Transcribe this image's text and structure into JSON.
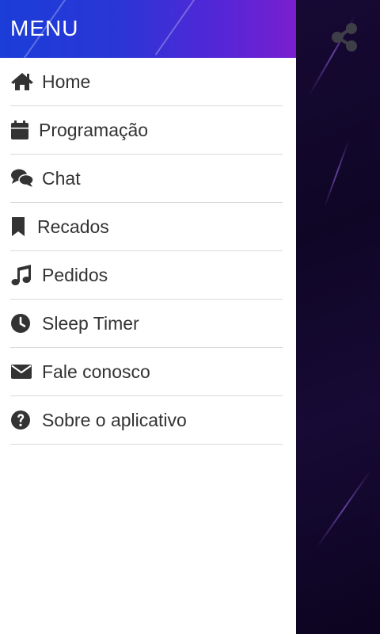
{
  "drawer": {
    "title": "MENU",
    "items": [
      {
        "label": "Home",
        "icon": "home-icon"
      },
      {
        "label": "Programação",
        "icon": "calendar-icon"
      },
      {
        "label": "Chat",
        "icon": "chat-icon"
      },
      {
        "label": "Recados",
        "icon": "bookmark-icon"
      },
      {
        "label": "Pedidos",
        "icon": "music-icon"
      },
      {
        "label": "Sleep Timer",
        "icon": "clock-icon"
      },
      {
        "label": "Fale conosco",
        "icon": "envelope-icon"
      },
      {
        "label": "Sobre o aplicativo",
        "icon": "question-circle-icon"
      }
    ]
  },
  "share": {
    "icon": "share-icon"
  },
  "colors": {
    "header_start": "#1b3dd8",
    "header_end": "#7a1fd0",
    "icon": "#333333",
    "text": "#333333",
    "divider": "#d9d9d9",
    "background": "#0f0626"
  }
}
